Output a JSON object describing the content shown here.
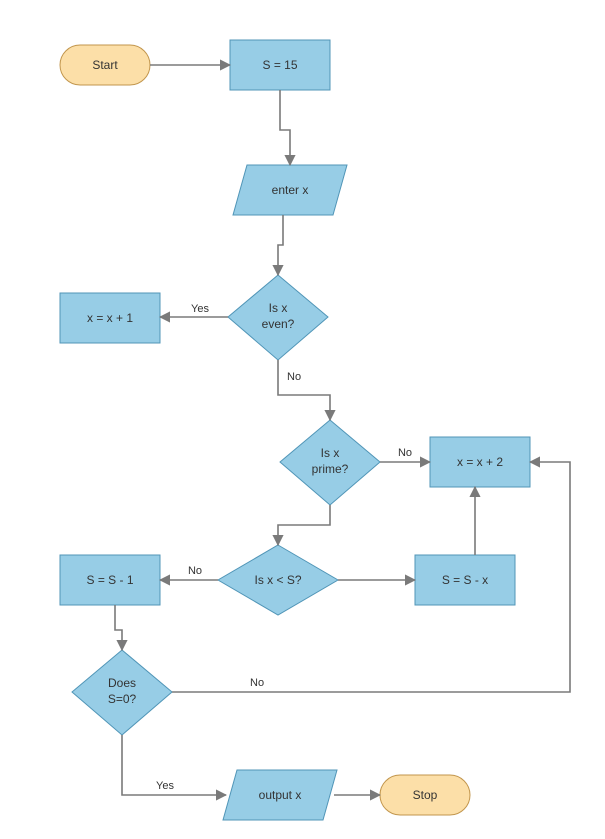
{
  "nodes": {
    "start": {
      "label": "Start"
    },
    "init": {
      "label": "S = 15"
    },
    "enterx": {
      "label": "enter x"
    },
    "even": {
      "line1": "Is x",
      "line2": "even?"
    },
    "xplus1": {
      "label": "x = x + 1"
    },
    "prime": {
      "line1": "Is x",
      "line2": "prime?"
    },
    "xplus2": {
      "label": "x = x + 2"
    },
    "lt": {
      "label": "Is x < S?"
    },
    "sminus1": {
      "label": "S = S - 1"
    },
    "sminusx": {
      "label": "S = S - x"
    },
    "szero": {
      "line1": "Does",
      "line2": "S=0?"
    },
    "outputx": {
      "label": "output x"
    },
    "stop": {
      "label": "Stop"
    }
  },
  "edges": {
    "even_yes": {
      "label": "Yes"
    },
    "even_no": {
      "label": "No"
    },
    "prime_no": {
      "label": "No"
    },
    "lt_no": {
      "label": "No"
    },
    "szero_no": {
      "label": "No"
    },
    "szero_yes": {
      "label": "Yes"
    }
  },
  "colors": {
    "terminator_fill": "#fcdfa8",
    "terminator_stroke": "#c2964d",
    "process_fill": "#97cde6",
    "process_stroke": "#5095b7",
    "edge_stroke": "#7a7a7a"
  }
}
